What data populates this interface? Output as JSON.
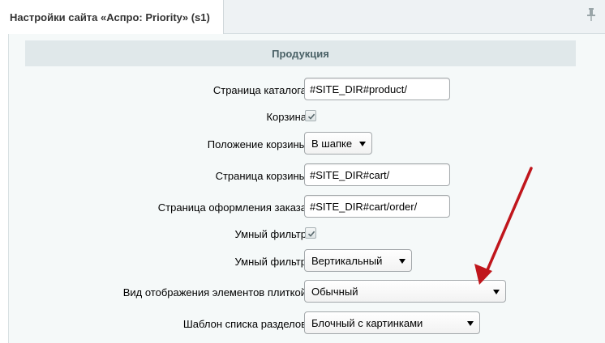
{
  "tab": {
    "title": "Настройки сайта «Аспро: Priority» (s1)"
  },
  "section": {
    "title": "Продукция"
  },
  "fields": {
    "catalog_page": {
      "label": "Страница каталога",
      "value": "#SITE_DIR#product/"
    },
    "basket": {
      "label": "Корзина",
      "checked": true
    },
    "basket_position": {
      "label": "Положение корзины",
      "value": "В шапке"
    },
    "basket_page": {
      "label": "Страница корзины",
      "value": "#SITE_DIR#cart/"
    },
    "order_page": {
      "label": "Страница оформления заказа",
      "value": "#SITE_DIR#cart/order/"
    },
    "smart_filter": {
      "label": "Умный фильтр",
      "checked": true
    },
    "smart_filter_type": {
      "label": "Умный фильтр",
      "value": "Вертикальный"
    },
    "tile_view": {
      "label": "Вид отображения элементов плиткой",
      "value": "Обычный"
    },
    "sections_template": {
      "label": "Шаблон списка разделов",
      "value": "Блочный с картинками"
    }
  },
  "colors": {
    "annotation_arrow": "#c0161c",
    "section_header_bg": "#e0e8ea",
    "content_bg": "#f5f9f9"
  },
  "icons": {
    "pin": "pin-icon",
    "check": "checkmark-icon",
    "dropdown": "chevron-down-icon"
  }
}
